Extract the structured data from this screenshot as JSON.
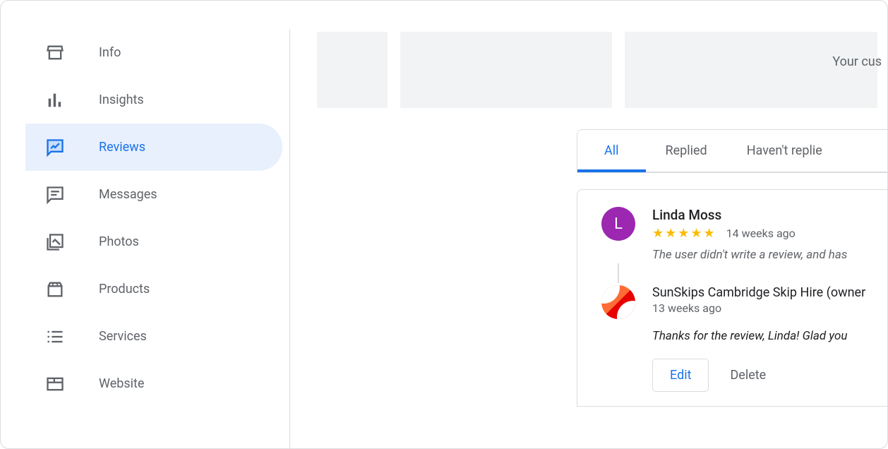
{
  "sidebar": {
    "items": [
      {
        "label": "Info"
      },
      {
        "label": "Insights"
      },
      {
        "label": "Reviews"
      },
      {
        "label": "Messages"
      },
      {
        "label": "Photos"
      },
      {
        "label": "Products"
      },
      {
        "label": "Services"
      },
      {
        "label": "Website"
      }
    ]
  },
  "header": {
    "partial_text": "Your cus"
  },
  "tabs": {
    "all": "All",
    "replied": "Replied",
    "havent_replied": "Haven't replie"
  },
  "review": {
    "reviewer_name": "Linda Moss",
    "reviewer_initial": "L",
    "stars": "★★★★★",
    "time_ago": "14 weeks ago",
    "review_text": "The user didn't write a review, and has",
    "owner_name": "SunSkips Cambridge Skip Hire (owner",
    "reply_time": "13 weeks ago",
    "reply_text": "Thanks for the review, Linda! Glad you",
    "edit_label": "Edit",
    "delete_label": "Delete"
  }
}
